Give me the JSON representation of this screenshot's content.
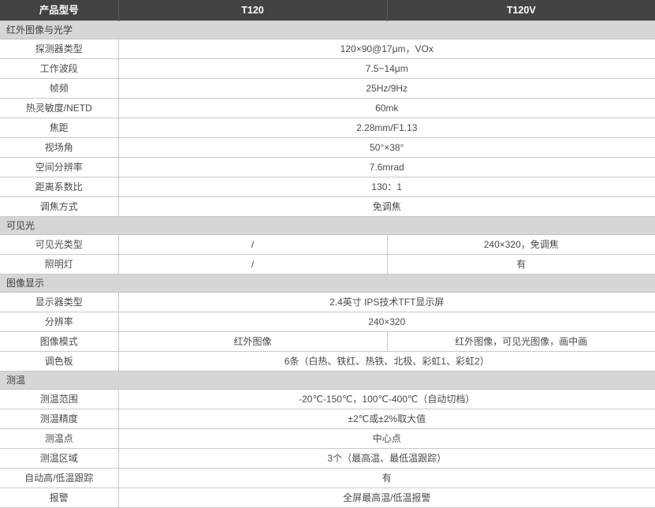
{
  "table": {
    "header": {
      "label_col": "产品型号",
      "col_a": "T120",
      "col_b": "T120V"
    },
    "sections": [
      {
        "title": "红外图像与光学",
        "rows": [
          {
            "label": "探测器类型",
            "span": true,
            "value": "120×90@17μm，VOx"
          },
          {
            "label": "工作波段",
            "span": true,
            "value": "7.5~14μm"
          },
          {
            "label": "帧频",
            "span": true,
            "value": "25Hz/9Hz"
          },
          {
            "label": "热灵敏度/NETD",
            "span": true,
            "value": "60mk"
          },
          {
            "label": "焦距",
            "span": true,
            "value": "2.28mm/F1.13"
          },
          {
            "label": "视场角",
            "span": true,
            "value": "50°×38°"
          },
          {
            "label": "空间分辨率",
            "span": true,
            "value": "7.6mrad"
          },
          {
            "label": "距离系数比",
            "span": true,
            "value": "130：1"
          },
          {
            "label": "调焦方式",
            "span": true,
            "value": "免调焦"
          }
        ]
      },
      {
        "title": "可见光",
        "rows": [
          {
            "label": "可见光类型",
            "span": false,
            "value_a": "/",
            "value_b": "240×320，免调焦"
          },
          {
            "label": "照明灯",
            "span": false,
            "value_a": "/",
            "value_b": "有"
          }
        ]
      },
      {
        "title": "图像显示",
        "rows": [
          {
            "label": "显示器类型",
            "span": true,
            "value": "2.4英寸 IPS技术TFT显示屏"
          },
          {
            "label": "分辨率",
            "span": true,
            "value": "240×320"
          },
          {
            "label": "图像模式",
            "span": false,
            "value_a": "红外图像",
            "value_b": "红外图像，可见光图像，画中画"
          },
          {
            "label": "调色板",
            "span": true,
            "value": "6条（白热、铁红、热铁、北极、彩虹1、彩虹2）"
          }
        ]
      },
      {
        "title": "测温",
        "rows": [
          {
            "label": "测温范围",
            "span": true,
            "value": "-20℃-150℃，100℃-400℃（自动切档）"
          },
          {
            "label": "测温精度",
            "span": true,
            "value": "±2℃或±2%取大值"
          },
          {
            "label": "测温点",
            "span": true,
            "value": "中心点"
          },
          {
            "label": "测温区域",
            "span": true,
            "value": "3个（最高温、最低温跟踪）"
          },
          {
            "label": "自动高/低温跟踪",
            "span": true,
            "value": "有"
          },
          {
            "label": "报警",
            "span": true,
            "value": "全屏最高温/低温报警"
          }
        ]
      }
    ]
  },
  "colors": {
    "header_bg": "#434343",
    "section_bg": "#d6d6d6",
    "border": "#c9c9c9",
    "text": "#4a4a4a"
  }
}
